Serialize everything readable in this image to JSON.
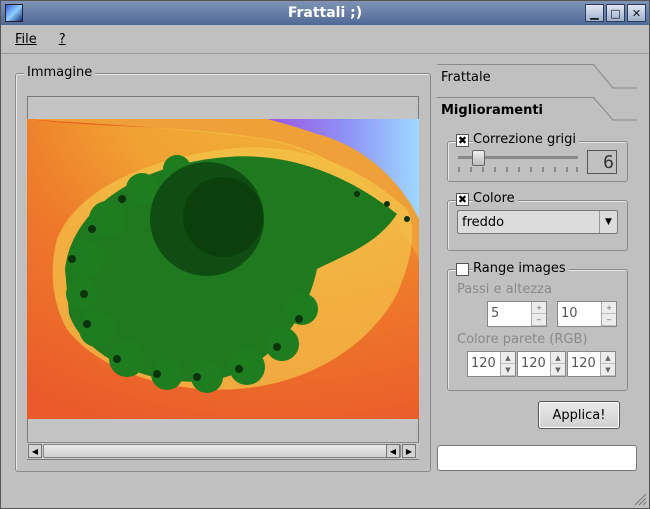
{
  "window": {
    "title": "Frattali ;)"
  },
  "menu": {
    "file": "File",
    "help": "?"
  },
  "image_panel": {
    "title": "Immagine"
  },
  "tabs": {
    "frattale": "Frattale",
    "miglioramenti": "Miglioramenti"
  },
  "grey_correction": {
    "label": "Correzione grigi",
    "checked": true,
    "slider_fraction": 0.15,
    "lcd_value": "6"
  },
  "color": {
    "label": "Colore",
    "checked": true,
    "selected": "freddo"
  },
  "range_images": {
    "label": "Range images",
    "checked": false,
    "steps_label": "Passi e altezza",
    "steps": "5",
    "height": "10",
    "wall_label": "Colore parete (RGB)",
    "r": "120",
    "g": "120",
    "b": "120"
  },
  "apply_button": "Applica!",
  "status_text": "",
  "colors": {
    "title_bar": "#5a729d",
    "background": "#c0c0c0"
  }
}
